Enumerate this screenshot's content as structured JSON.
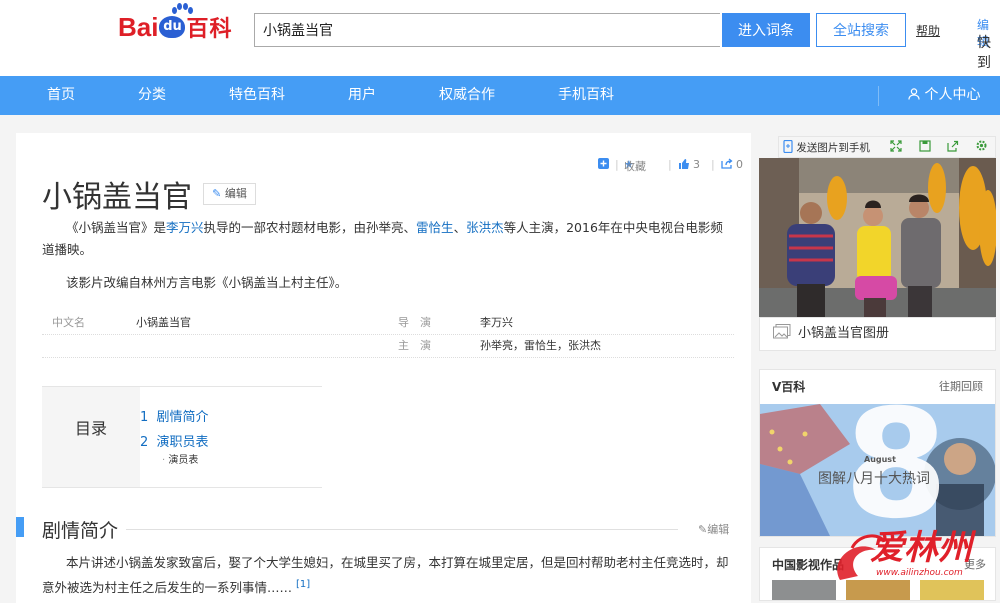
{
  "header": {
    "logo_bai": "Bai",
    "logo_du": "du",
    "logo_baike": "百科",
    "search_value": "小锅盖当官",
    "enter_button": "进入词条",
    "site_search_button": "全站搜索",
    "help_link": "帮助",
    "edit_link": "编辑",
    "fast_text": "快到"
  },
  "nav": {
    "items": [
      "首页",
      "分类",
      "特色百科",
      "用户",
      "权威合作",
      "手机百科"
    ],
    "personal_center": "个人中心"
  },
  "toolbar": {
    "favorite": "收藏",
    "like_count": "3",
    "share_count": "0"
  },
  "entry": {
    "title": "小锅盖当官",
    "edit_label": "编辑",
    "intro": {
      "p1_prefix": "《小锅盖当官》是",
      "director_link": "李万兴",
      "p1_mid": "执导的一部农村题材电影，由孙举亮、",
      "actor_link1": "雷恰生",
      "sep": "、",
      "actor_link2": "张洪杰",
      "p1_suffix": "等人主演，2016年在中央电视台电影频道播映。",
      "p2": "该影片改编自林州方言电影《小锅盖当上村主任》。"
    },
    "infobox": {
      "row1": {
        "label1": "中文名",
        "value1": "小锅盖当官",
        "label2": "导　演",
        "value2": "李万兴"
      },
      "row2": {
        "label2": "主　演",
        "value2": "孙举亮，雷恰生，张洪杰"
      }
    },
    "toc": {
      "title": "目录",
      "items": [
        {
          "num": "1",
          "label": "剧情简介"
        },
        {
          "num": "2",
          "label": "演职员表"
        }
      ],
      "sub": "演员表"
    },
    "section": {
      "title": "剧情简介",
      "edit_label": "编辑",
      "text": "本片讲述小锅盖发家致富后，娶了个大学生媳妇，在城里买了房，本打算在城里定居，但是回村帮助老村主任竞选时，却意外被选为村主任之后发生的一系列事情……",
      "ref": "[1]"
    }
  },
  "sidebar": {
    "send_to_phone": "发送图片到手机",
    "album_label": "小锅盖当官图册",
    "vbaike": {
      "title": "V百科",
      "more": "往期回顾",
      "month_text": "August",
      "big_number": "8",
      "caption": "图解八月十大热词"
    },
    "film_box": {
      "title": "中国影视作品",
      "more": "更多"
    }
  },
  "watermark": {
    "name": "爱林州",
    "url": "www.ailinzhou.com"
  },
  "colors": {
    "nav_blue": "#459df5",
    "button_blue": "#3c8df0",
    "link_blue": "#136ec2",
    "logo_red": "#de1f27",
    "watermark_red": "#e0202a"
  }
}
